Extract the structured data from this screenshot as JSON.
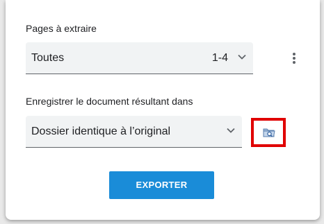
{
  "pages": {
    "label": "Pages à extraire",
    "selected": "Toutes",
    "range": "1-4"
  },
  "destination": {
    "label": "Enregistrer le document résultant dans",
    "selected": "Dossier identique à l’original"
  },
  "actions": {
    "export_label": "EXPORTER"
  },
  "colors": {
    "accent": "#1a8cd8",
    "highlight_box": "#e00000"
  },
  "icons": {
    "chevron": "chevron-down-icon",
    "more": "more-vertical-icon",
    "folder": "folder-search-icon"
  }
}
